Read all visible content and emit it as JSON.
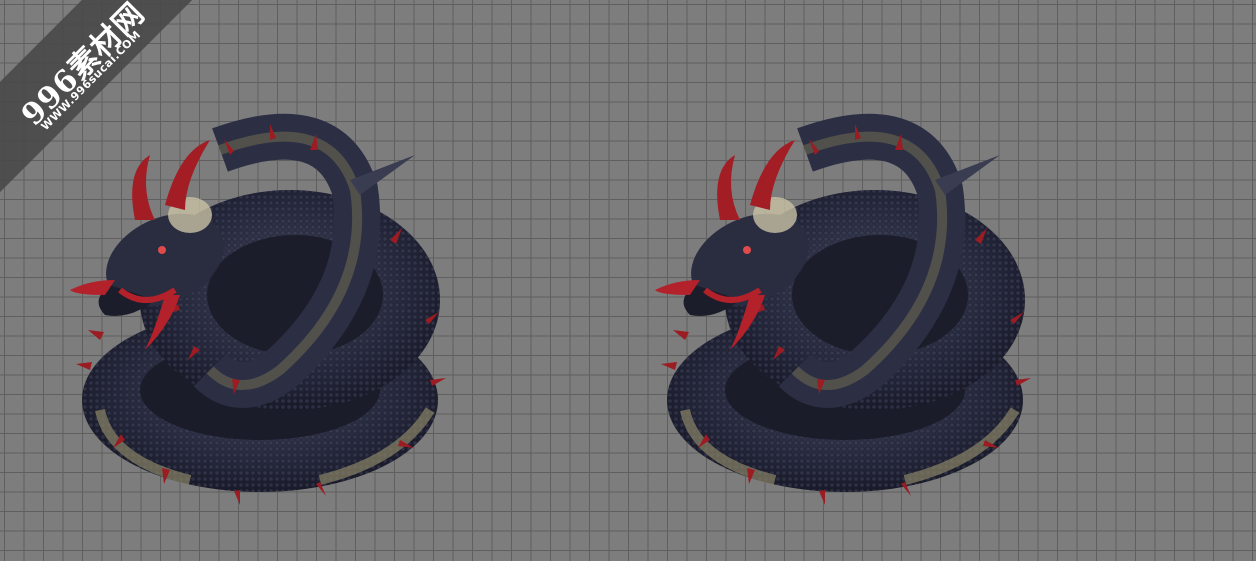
{
  "watermark": {
    "brand": "996素材网",
    "url": "WWW.996sucai.COM"
  },
  "figures": [
    {
      "name": "coiled-serpent-dragon",
      "subject": "dragon-icon"
    },
    {
      "name": "coiled-serpent-dragon",
      "subject": "dragon-icon"
    }
  ],
  "colors": {
    "background": "#7d7d7d",
    "grid_line": "#5f5f5f",
    "scales": "#2b2d3e",
    "spikes": "#9b1c22",
    "belly": "#8a8568"
  }
}
